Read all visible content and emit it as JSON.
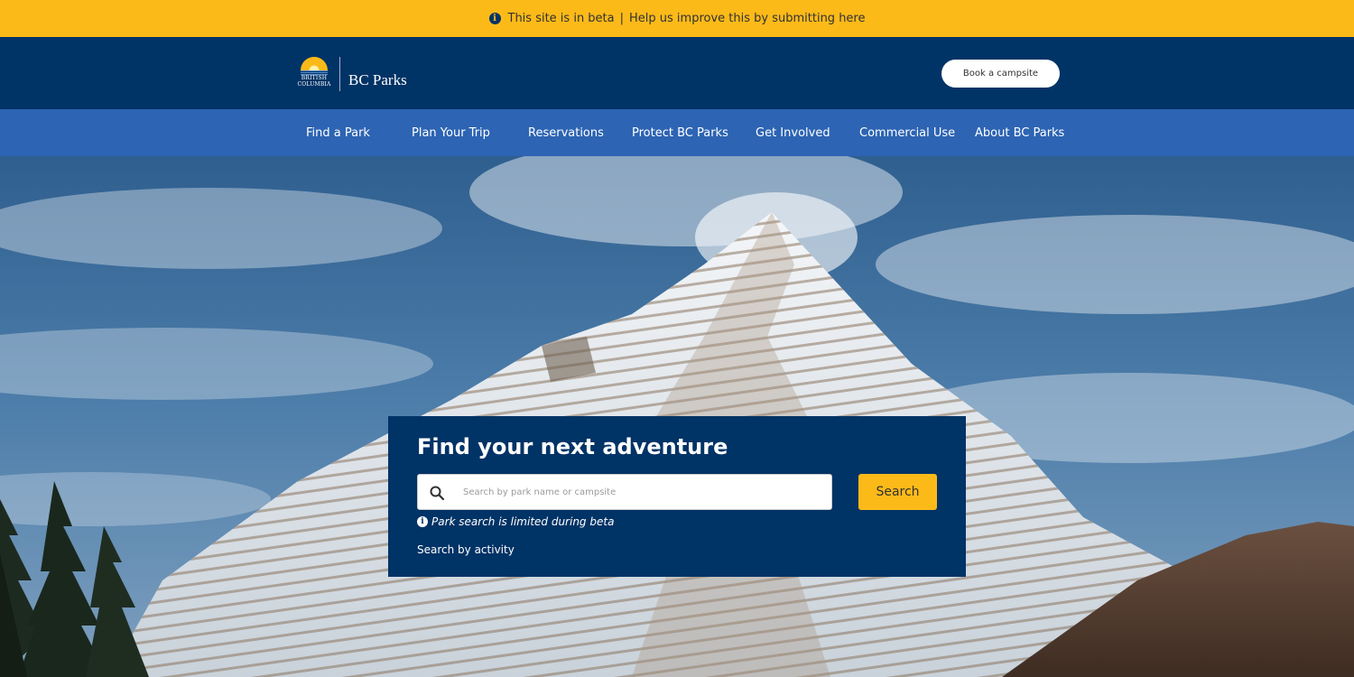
{
  "beta_banner": {
    "icon": "info-icon",
    "message": "This site is in beta",
    "separator": "|",
    "link_text": "Help us improve this by submitting here",
    "background": "#fcba19"
  },
  "header": {
    "logo": {
      "gov_line1": "BRITISH",
      "gov_line2": "COLUMBIA",
      "name": "BC Parks"
    },
    "book_button": "Book a campsite",
    "background": "#003366"
  },
  "nav": {
    "background": "#2d64b3",
    "items": [
      {
        "label": "Find a Park"
      },
      {
        "label": "Plan Your Trip"
      },
      {
        "label": "Reservations"
      },
      {
        "label": "Protect BC Parks"
      },
      {
        "label": "Get Involved"
      },
      {
        "label": "Commercial Use"
      },
      {
        "label": "About BC Parks"
      }
    ]
  },
  "search": {
    "title": "Find your next adventure",
    "placeholder": "Search by park name or campsite",
    "value": "",
    "button": "Search",
    "note": "Park search is limited during beta",
    "activity_link": "Search by activity",
    "accent": "#fcba19"
  }
}
